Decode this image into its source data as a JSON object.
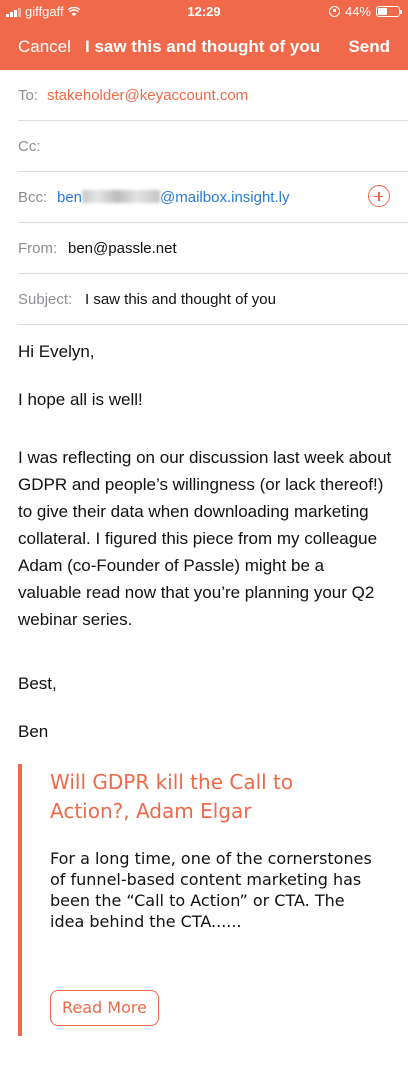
{
  "status_bar": {
    "carrier": "giffgaff",
    "time": "12:29",
    "battery": "44%",
    "battery_level": 0.44
  },
  "nav": {
    "cancel_label": "Cancel",
    "title": "I saw this and thought of you",
    "send_label": "Send"
  },
  "fields": {
    "to_label": "To:",
    "to_value": "stakeholder@keyaccount.com",
    "cc_label": "Cc:",
    "bcc_label": "Bcc:",
    "bcc_prefix": "ben",
    "bcc_suffix": "@mailbox.insight.ly",
    "from_label": "From:",
    "from_value": "ben@passle.net",
    "subject_label": "Subject:",
    "subject_value": "I saw this and thought of you"
  },
  "body": {
    "greeting": "Hi Evelyn,",
    "line1": "I hope all is well!",
    "paragraph": "I was reflecting on our discussion last week about GDPR and people’s willingness (or lack thereof!) to give their data when downloading marketing collateral. I figured this piece from my colleague Adam (co-Founder of Passle) might be a valuable read now that you’re planning your Q2 webinar series.",
    "signoff": "Best,",
    "signature": "Ben"
  },
  "quote": {
    "title": "Will GDPR kill the Call to Action?, Adam Elgar",
    "excerpt": "For a long time, one of the cornerstones of funnel-based content marketing has been the “Call to Action” or CTA. The idea behind the CTA......",
    "read_more_label": "Read More"
  },
  "colors": {
    "accent": "#f0694a",
    "link": "#2b7ad6",
    "label_gray": "#8e8e93"
  }
}
